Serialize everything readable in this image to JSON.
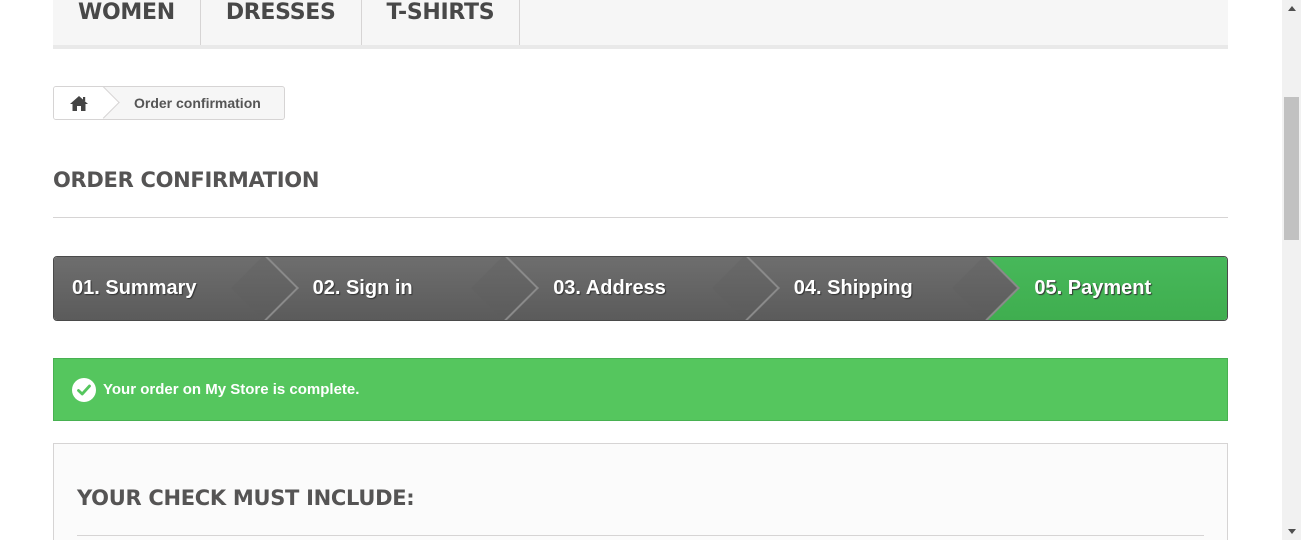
{
  "nav": {
    "items": [
      "WOMEN",
      "DRESSES",
      "T-SHIRTS"
    ]
  },
  "breadcrumb": {
    "home_icon": "home-icon",
    "current": "Order confirmation"
  },
  "page": {
    "title": "ORDER CONFIRMATION"
  },
  "steps": [
    {
      "label": "01. Summary",
      "active": false
    },
    {
      "label": "02. Sign in",
      "active": false
    },
    {
      "label": "03. Address",
      "active": false
    },
    {
      "label": "04. Shipping",
      "active": false
    },
    {
      "label": "05. Payment",
      "active": true
    }
  ],
  "alert": {
    "icon": "check-circle-icon",
    "text": "Your order on My Store is complete."
  },
  "box": {
    "title": "YOUR CHECK MUST INCLUDE:"
  },
  "colors": {
    "success": "#55c65e",
    "step_active": "#43b455",
    "step_inactive": "#636363"
  }
}
